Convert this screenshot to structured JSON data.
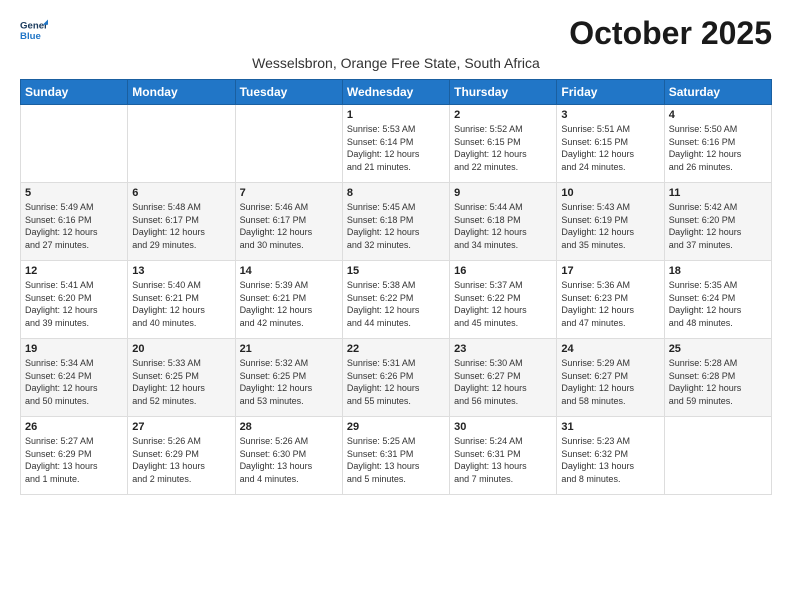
{
  "header": {
    "logo_line1": "General",
    "logo_line2": "Blue",
    "month_title": "October 2025",
    "subtitle": "Wesselsbron, Orange Free State, South Africa"
  },
  "days_of_week": [
    "Sunday",
    "Monday",
    "Tuesday",
    "Wednesday",
    "Thursday",
    "Friday",
    "Saturday"
  ],
  "weeks": [
    [
      {
        "day": "",
        "info": ""
      },
      {
        "day": "",
        "info": ""
      },
      {
        "day": "",
        "info": ""
      },
      {
        "day": "1",
        "info": "Sunrise: 5:53 AM\nSunset: 6:14 PM\nDaylight: 12 hours\nand 21 minutes."
      },
      {
        "day": "2",
        "info": "Sunrise: 5:52 AM\nSunset: 6:15 PM\nDaylight: 12 hours\nand 22 minutes."
      },
      {
        "day": "3",
        "info": "Sunrise: 5:51 AM\nSunset: 6:15 PM\nDaylight: 12 hours\nand 24 minutes."
      },
      {
        "day": "4",
        "info": "Sunrise: 5:50 AM\nSunset: 6:16 PM\nDaylight: 12 hours\nand 26 minutes."
      }
    ],
    [
      {
        "day": "5",
        "info": "Sunrise: 5:49 AM\nSunset: 6:16 PM\nDaylight: 12 hours\nand 27 minutes."
      },
      {
        "day": "6",
        "info": "Sunrise: 5:48 AM\nSunset: 6:17 PM\nDaylight: 12 hours\nand 29 minutes."
      },
      {
        "day": "7",
        "info": "Sunrise: 5:46 AM\nSunset: 6:17 PM\nDaylight: 12 hours\nand 30 minutes."
      },
      {
        "day": "8",
        "info": "Sunrise: 5:45 AM\nSunset: 6:18 PM\nDaylight: 12 hours\nand 32 minutes."
      },
      {
        "day": "9",
        "info": "Sunrise: 5:44 AM\nSunset: 6:18 PM\nDaylight: 12 hours\nand 34 minutes."
      },
      {
        "day": "10",
        "info": "Sunrise: 5:43 AM\nSunset: 6:19 PM\nDaylight: 12 hours\nand 35 minutes."
      },
      {
        "day": "11",
        "info": "Sunrise: 5:42 AM\nSunset: 6:20 PM\nDaylight: 12 hours\nand 37 minutes."
      }
    ],
    [
      {
        "day": "12",
        "info": "Sunrise: 5:41 AM\nSunset: 6:20 PM\nDaylight: 12 hours\nand 39 minutes."
      },
      {
        "day": "13",
        "info": "Sunrise: 5:40 AM\nSunset: 6:21 PM\nDaylight: 12 hours\nand 40 minutes."
      },
      {
        "day": "14",
        "info": "Sunrise: 5:39 AM\nSunset: 6:21 PM\nDaylight: 12 hours\nand 42 minutes."
      },
      {
        "day": "15",
        "info": "Sunrise: 5:38 AM\nSunset: 6:22 PM\nDaylight: 12 hours\nand 44 minutes."
      },
      {
        "day": "16",
        "info": "Sunrise: 5:37 AM\nSunset: 6:22 PM\nDaylight: 12 hours\nand 45 minutes."
      },
      {
        "day": "17",
        "info": "Sunrise: 5:36 AM\nSunset: 6:23 PM\nDaylight: 12 hours\nand 47 minutes."
      },
      {
        "day": "18",
        "info": "Sunrise: 5:35 AM\nSunset: 6:24 PM\nDaylight: 12 hours\nand 48 minutes."
      }
    ],
    [
      {
        "day": "19",
        "info": "Sunrise: 5:34 AM\nSunset: 6:24 PM\nDaylight: 12 hours\nand 50 minutes."
      },
      {
        "day": "20",
        "info": "Sunrise: 5:33 AM\nSunset: 6:25 PM\nDaylight: 12 hours\nand 52 minutes."
      },
      {
        "day": "21",
        "info": "Sunrise: 5:32 AM\nSunset: 6:25 PM\nDaylight: 12 hours\nand 53 minutes."
      },
      {
        "day": "22",
        "info": "Sunrise: 5:31 AM\nSunset: 6:26 PM\nDaylight: 12 hours\nand 55 minutes."
      },
      {
        "day": "23",
        "info": "Sunrise: 5:30 AM\nSunset: 6:27 PM\nDaylight: 12 hours\nand 56 minutes."
      },
      {
        "day": "24",
        "info": "Sunrise: 5:29 AM\nSunset: 6:27 PM\nDaylight: 12 hours\nand 58 minutes."
      },
      {
        "day": "25",
        "info": "Sunrise: 5:28 AM\nSunset: 6:28 PM\nDaylight: 12 hours\nand 59 minutes."
      }
    ],
    [
      {
        "day": "26",
        "info": "Sunrise: 5:27 AM\nSunset: 6:29 PM\nDaylight: 13 hours\nand 1 minute."
      },
      {
        "day": "27",
        "info": "Sunrise: 5:26 AM\nSunset: 6:29 PM\nDaylight: 13 hours\nand 2 minutes."
      },
      {
        "day": "28",
        "info": "Sunrise: 5:26 AM\nSunset: 6:30 PM\nDaylight: 13 hours\nand 4 minutes."
      },
      {
        "day": "29",
        "info": "Sunrise: 5:25 AM\nSunset: 6:31 PM\nDaylight: 13 hours\nand 5 minutes."
      },
      {
        "day": "30",
        "info": "Sunrise: 5:24 AM\nSunset: 6:31 PM\nDaylight: 13 hours\nand 7 minutes."
      },
      {
        "day": "31",
        "info": "Sunrise: 5:23 AM\nSunset: 6:32 PM\nDaylight: 13 hours\nand 8 minutes."
      },
      {
        "day": "",
        "info": ""
      }
    ]
  ]
}
